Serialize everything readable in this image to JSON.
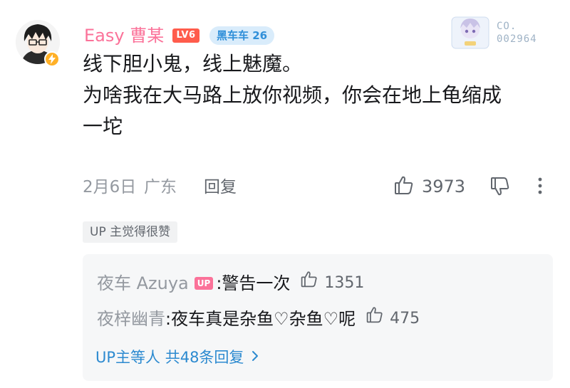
{
  "comment": {
    "username": "Easy 曹某",
    "level_badge": "LV6",
    "fan_badge": "黑车车 26",
    "card_label": "CO.",
    "card_number": "002964",
    "content_lines": [
      "线下胆小鬼，线上魅魔。",
      "为啥我在大马路上放你视频，你会在地上龟缩成",
      "一坨"
    ],
    "date": "2月6日",
    "location": "广东",
    "reply_label": "回复",
    "like_count": "3973",
    "up_liked_tag": "UP 主觉得很赞"
  },
  "replies": {
    "items": [
      {
        "name": "夜车 Azuya",
        "up_badge": "UP",
        "separator": ":",
        "text": " 警告一次",
        "likes": "1351"
      },
      {
        "name": "夜梓幽青",
        "separator": ":",
        "text": " 夜车真是杂鱼♡杂鱼♡呢",
        "likes": "475"
      }
    ],
    "more_label": "UP主等人 共48条回复",
    "more_chevron": "›"
  },
  "icons": {
    "avatar": "avatar",
    "vip_badge": "lightning-badge-icon",
    "like": "thumbs-up-icon",
    "dislike": "thumbs-down-icon",
    "more": "vertical-dots-icon",
    "chevron": "chevron-right-icon"
  },
  "colors": {
    "username": "#fb7299",
    "level_badge": "#ff5c4c",
    "fan_badge_bg": "#d9ecfb",
    "fan_badge_text": "#2f8fd9",
    "link": "#2c8ad0",
    "muted": "#9499a0"
  }
}
